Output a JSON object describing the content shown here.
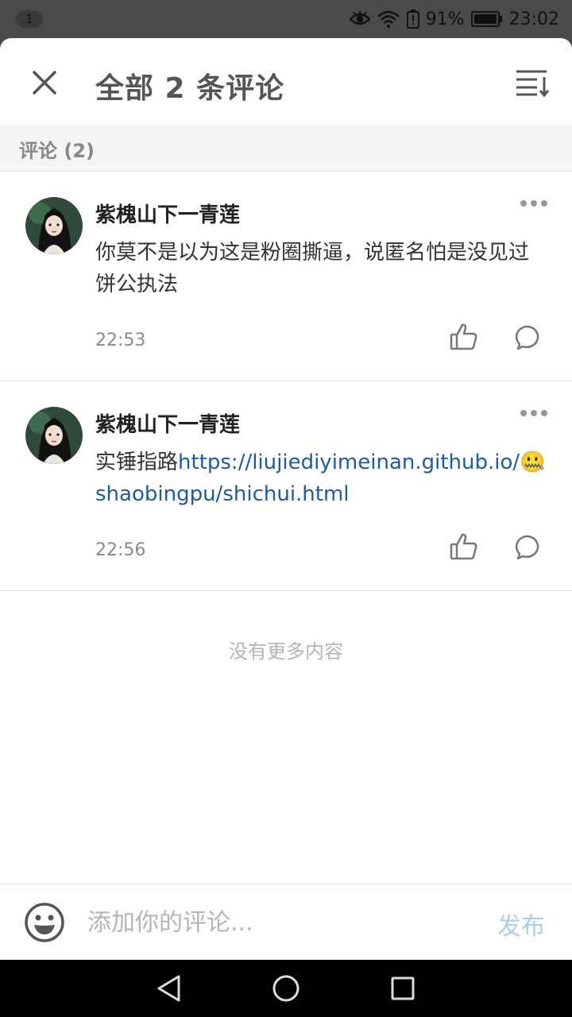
{
  "status_bar": {
    "notification_count": "1",
    "battery": "91%",
    "time": "23:02"
  },
  "header": {
    "title": "全部 2 条评论",
    "close_icon": "close-icon",
    "sort_icon": "sort-icon"
  },
  "section": {
    "label": "评论 (2)"
  },
  "comments": [
    {
      "username": "紫槐山下一青莲",
      "text": "你莫不是以为这是粉圈撕逼，说匿名怕是没见过饼公执法",
      "time": "22:53"
    },
    {
      "username": "紫槐山下一青莲",
      "text_prefix": "实锤指路",
      "link": "https://liujiediyimeinan.github.io/",
      "emoji": "🤐",
      "link_rest": "shaobingpu/shichui.html",
      "time": "22:56"
    }
  ],
  "footer_note": "没有更多内容",
  "input_bar": {
    "placeholder": "添加你的评论...",
    "publish_label": "发布"
  },
  "colors": {
    "link": "#1e5b9a",
    "publish": "#a8d0f0",
    "muted": "#8a8a8a"
  }
}
